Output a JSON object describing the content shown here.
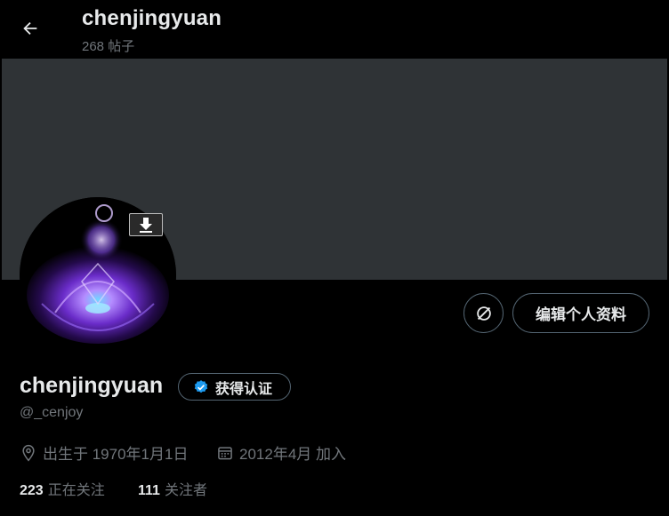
{
  "header": {
    "title": "chenjingyuan",
    "post_count": "268 帖子"
  },
  "profile": {
    "display_name": "chenjingyuan",
    "verify_label": "获得认证",
    "handle": "@_cenjoy",
    "birth": "出生于 1970年1月1日",
    "joined": "2012年4月 加入",
    "following_count": "223",
    "following_label": "正在关注",
    "followers_count": "111",
    "followers_label": "关注者",
    "edit_label": "编辑个人资料"
  },
  "icons": {
    "back": "arrow-left-icon",
    "download": "download-icon",
    "sync": "no-sync-icon",
    "verified": "verified-badge-icon",
    "location": "location-pin-icon",
    "calendar": "calendar-icon"
  },
  "colors": {
    "background": "#000000",
    "banner": "#2f3336",
    "border": "#536471",
    "secondary_text": "#71767b",
    "verified_blue": "#1d9bf0"
  }
}
